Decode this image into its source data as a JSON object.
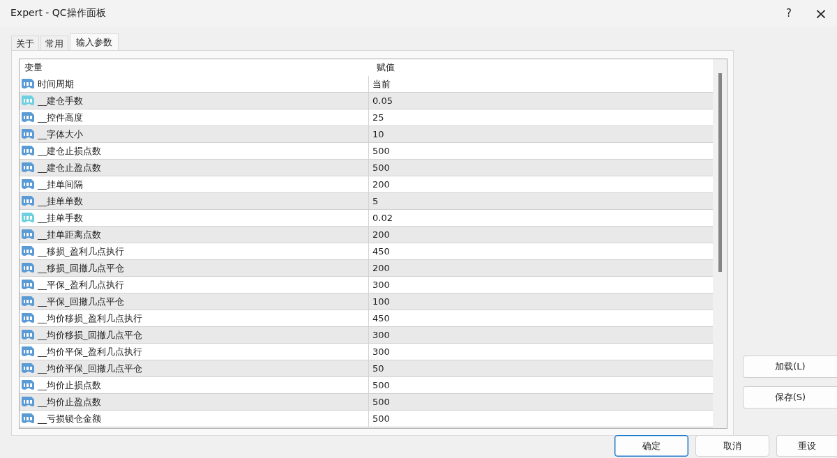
{
  "window": {
    "title": "Expert - QC操作面板",
    "help": "?",
    "close": "×"
  },
  "tabs": [
    {
      "label": "关于",
      "selected": false
    },
    {
      "label": "常用",
      "selected": false
    },
    {
      "label": "输入参数",
      "selected": true
    }
  ],
  "table": {
    "columns": [
      "变量",
      "赋值"
    ],
    "rows": [
      {
        "kind": "int",
        "name": "时间周期",
        "value": "当前"
      },
      {
        "kind": "double",
        "name": "__建仓手数",
        "value": "0.05"
      },
      {
        "kind": "int",
        "name": "__控件高度",
        "value": "25"
      },
      {
        "kind": "int",
        "name": "__字体大小",
        "value": "10"
      },
      {
        "kind": "int",
        "name": "__建仓止损点数",
        "value": "500"
      },
      {
        "kind": "int",
        "name": "__建仓止盈点数",
        "value": "500"
      },
      {
        "kind": "int",
        "name": "__挂单间隔",
        "value": "200"
      },
      {
        "kind": "int",
        "name": "__挂单单数",
        "value": "5"
      },
      {
        "kind": "double",
        "name": "__挂单手数",
        "value": "0.02"
      },
      {
        "kind": "int",
        "name": "__挂单距离点数",
        "value": "200"
      },
      {
        "kind": "int",
        "name": "__移损_盈利几点执行",
        "value": "450"
      },
      {
        "kind": "int",
        "name": "__移损_回撤几点平仓",
        "value": "200"
      },
      {
        "kind": "int",
        "name": "__平保_盈利几点执行",
        "value": "300"
      },
      {
        "kind": "int",
        "name": "__平保_回撤几点平仓",
        "value": "100"
      },
      {
        "kind": "int",
        "name": "__均价移损_盈利几点执行",
        "value": "450"
      },
      {
        "kind": "int",
        "name": "__均价移损_回撤几点平仓",
        "value": "300"
      },
      {
        "kind": "int",
        "name": "__均价平保_盈利几点执行",
        "value": "300"
      },
      {
        "kind": "int",
        "name": "__均价平保_回撤几点平仓",
        "value": "50"
      },
      {
        "kind": "int",
        "name": "__均价止损点数",
        "value": "500"
      },
      {
        "kind": "int",
        "name": "__均价止盈点数",
        "value": "500"
      },
      {
        "kind": "int",
        "name": "__亏损锁仓金额",
        "value": "500"
      }
    ]
  },
  "side_buttons": [
    "加载(L)",
    "保存(S)"
  ],
  "buttons": [
    {
      "label": "确定",
      "selected": true
    },
    {
      "label": "取消",
      "selected": false
    },
    {
      "label": "重设",
      "selected": false
    }
  ]
}
